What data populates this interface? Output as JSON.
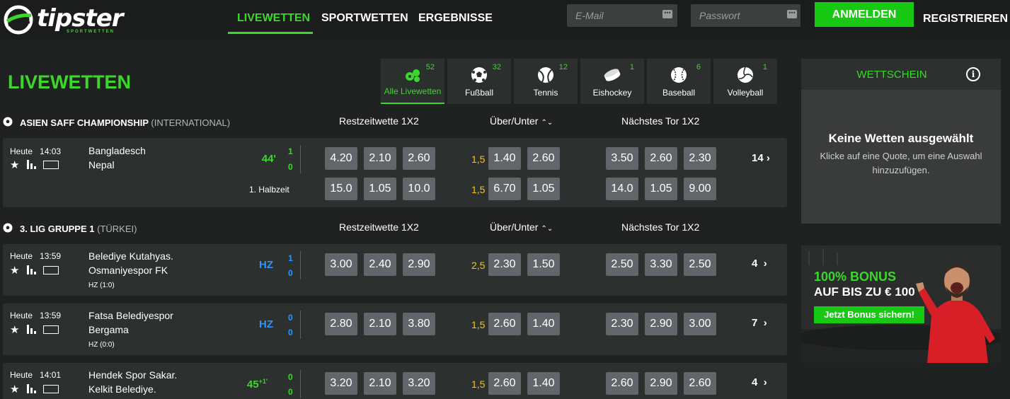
{
  "brand": {
    "name": "tipster",
    "tagline": "SPORTWETTEN"
  },
  "nav": [
    {
      "label": "LIVEWETTEN",
      "active": true
    },
    {
      "label": "SPORTWETTEN",
      "active": false
    },
    {
      "label": "ERGEBNISSE",
      "active": false
    }
  ],
  "login": {
    "email_placeholder": "E-Mail",
    "password_placeholder": "Passwort",
    "login_label": "ANMELDEN",
    "register_label": "REGISTRIEREN"
  },
  "page_title": "LIVEWETTEN",
  "sports": [
    {
      "label": "Alle Livewetten",
      "count": "52",
      "icon": "multi-sport-icon",
      "active": true
    },
    {
      "label": "Fußball",
      "count": "32",
      "icon": "football-icon",
      "active": false
    },
    {
      "label": "Tennis",
      "count": "12",
      "icon": "tennis-icon",
      "active": false
    },
    {
      "label": "Eishockey",
      "count": "1",
      "icon": "ice-hockey-icon",
      "active": false
    },
    {
      "label": "Baseball",
      "count": "6",
      "icon": "baseball-icon",
      "active": false
    },
    {
      "label": "Volleyball",
      "count": "1",
      "icon": "volleyball-icon",
      "active": false
    }
  ],
  "leagues": [
    {
      "name": "ASIEN SAFF CHAMPIONSHIP",
      "region": "(INTERNATIONAL)",
      "col_rest": "Restzeitwette 1X2",
      "col_ou": "Über/Unter",
      "col_next": "Nächstes Tor 1X2",
      "matches": [
        {
          "date": "Heute",
          "time": "14:03",
          "home": "Bangladesch",
          "away": "Nepal",
          "minute": "44'",
          "score_home": "1",
          "score_away": "0",
          "period": "1. Halbzeit",
          "rows": [
            {
              "rest": [
                "4.20",
                "2.10",
                "2.60"
              ],
              "line": "1,5",
              "ou": [
                "1.40",
                "2.60"
              ],
              "next": [
                "3.50",
                "2.60",
                "2.30"
              ]
            },
            {
              "rest": [
                "15.0",
                "1.05",
                "10.0"
              ],
              "line": "1,5",
              "ou": [
                "6.70",
                "1.05"
              ],
              "next": [
                "14.0",
                "1.05",
                "9.00"
              ]
            }
          ],
          "more": "14"
        }
      ]
    },
    {
      "name": "3. LIG GRUPPE 1",
      "region": "(TÜRKEI)",
      "col_rest": "Restzeitwette 1X2",
      "col_ou": "Über/Unter",
      "col_next": "Nächstes Tor 1X2",
      "matches": [
        {
          "date": "Heute",
          "time": "13:59",
          "home": "Belediye Kutahyas.",
          "away": "Osmaniyespor FK",
          "minute": "HZ",
          "score_home": "1",
          "score_away": "0",
          "sub": "HZ (1:0)",
          "rows": [
            {
              "rest": [
                "3.00",
                "2.40",
                "2.90"
              ],
              "line": "2,5",
              "ou": [
                "2.30",
                "1.50"
              ],
              "next": [
                "2.50",
                "3.30",
                "2.50"
              ]
            }
          ],
          "more": "4"
        },
        {
          "date": "Heute",
          "time": "13:59",
          "home": "Fatsa Belediyespor",
          "away": "Bergama",
          "minute": "HZ",
          "score_home": "0",
          "score_away": "0",
          "sub": "HZ (0:0)",
          "rows": [
            {
              "rest": [
                "2.80",
                "2.10",
                "3.80"
              ],
              "line": "1,5",
              "ou": [
                "2.60",
                "1.40"
              ],
              "next": [
                "2.30",
                "2.90",
                "3.00"
              ]
            }
          ],
          "more": "7"
        },
        {
          "date": "Heute",
          "time": "14:01",
          "home": "Hendek Spor Sakar.",
          "away": "Kelkit Belediye.",
          "minute": "45",
          "minute_extra": "+1'",
          "score_home": "0",
          "score_away": "0",
          "rows": [
            {
              "rest": [
                "3.20",
                "2.10",
                "3.20"
              ],
              "line": "1,5",
              "ou": [
                "2.60",
                "1.40"
              ],
              "next": [
                "2.60",
                "2.90",
                "2.60"
              ]
            }
          ],
          "more": "4"
        }
      ]
    }
  ],
  "betslip": {
    "title": "WETTSCHEIN",
    "empty_title": "Keine Wetten ausgewählt",
    "empty_hint": "Klicke auf eine Quote, um eine Auswahl hinzuzufügen."
  },
  "promo": {
    "line1": "100% BONUS",
    "line2": "AUF BIS ZU € 100",
    "cta": "Jetzt Bonus sichern!"
  },
  "colors": {
    "accent": "#3bd82b",
    "live_blue": "#2d95ff",
    "line_yellow": "#f5c518"
  }
}
